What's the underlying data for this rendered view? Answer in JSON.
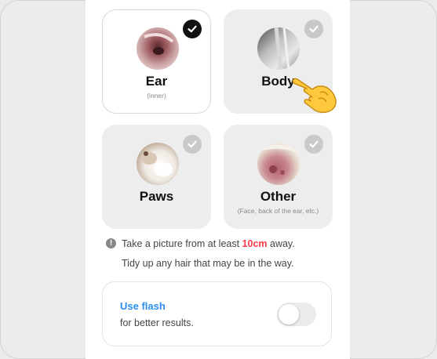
{
  "options": [
    {
      "id": "ear",
      "label": "Ear",
      "sublabel": "(inner)",
      "selected": true,
      "thumb_icon": "ear-photo"
    },
    {
      "id": "body",
      "label": "Body",
      "sublabel": "",
      "selected": false,
      "thumb_icon": "body-fur-photo"
    },
    {
      "id": "paws",
      "label": "Paws",
      "sublabel": "",
      "selected": false,
      "thumb_icon": "paw-photo"
    },
    {
      "id": "other",
      "label": "Other",
      "sublabel": "(Face, back of the ear, etc.)",
      "selected": false,
      "thumb_icon": "skin-photo"
    }
  ],
  "tips": {
    "line1_before": "Take a picture from at least ",
    "line1_highlight": "10cm",
    "line1_after": " away.",
    "line2": "Tidy up any hair that may be in the way."
  },
  "flash": {
    "title": "Use flash",
    "subtitle": "for better results.",
    "enabled": false
  },
  "colors": {
    "accent_blue": "#2b8ef0",
    "highlight_red": "#ff3b47",
    "check_on": "#111111",
    "check_off": "#c9c9cc",
    "card_unselected": "#ededed"
  },
  "icons": {
    "info": "info-icon",
    "check": "check-icon",
    "pointer": "pointing-hand-icon"
  }
}
